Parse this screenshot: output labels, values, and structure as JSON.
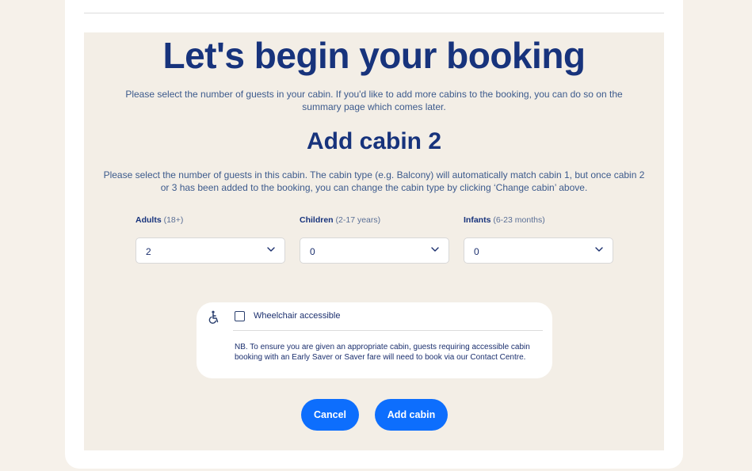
{
  "page": {
    "title": "Let's begin your booking",
    "intro": "Please select the number of guests in your cabin. If you'd like to add more cabins to the booking, you can do so on the summary page which comes later.",
    "subtitle": "Add cabin 2",
    "cabin_intro": "Please select the number of guests in this cabin. The cabin type (e.g. Balcony) will automatically match cabin 1, but once cabin 2 or 3 has been added to the booking, you can change the cabin type by clicking ‘Change cabin’ above."
  },
  "guests": {
    "adults": {
      "label": "Adults",
      "hint": "(18+)",
      "value": "2"
    },
    "children": {
      "label": "Children",
      "hint": "(2-17 years)",
      "value": "0"
    },
    "infants": {
      "label": "Infants",
      "hint": "(6-23 months)",
      "value": "0"
    }
  },
  "accessibility": {
    "icon": "wheelchair-icon",
    "checkbox_label": "Wheelchair accessible",
    "checked": false,
    "note": "NB. To ensure you are given an appropriate cabin, guests requiring accessible cabin booking with an Early Saver or Saver fare will need to book via our Contact Centre."
  },
  "actions": {
    "cancel": "Cancel",
    "add_cabin": "Add cabin"
  },
  "colors": {
    "primary": "#0d6efd",
    "heading": "#17337c",
    "page_bg": "#f6f1ea",
    "panel_bg": "#f3eee6"
  }
}
